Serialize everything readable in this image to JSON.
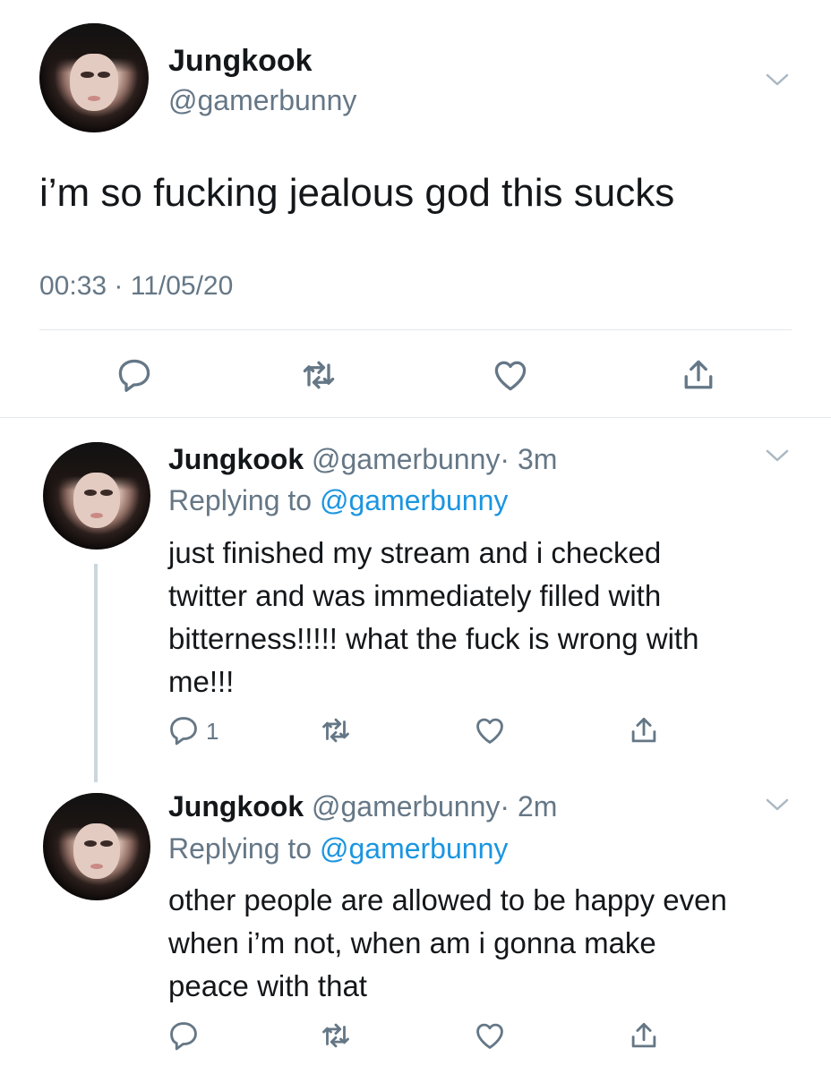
{
  "main_tweet": {
    "author_name": "Jungkook",
    "handle": "@gamerbunny",
    "text": "i’m so fucking jealous god this sucks",
    "timestamp": "00:33 · 11/05/20"
  },
  "replies": [
    {
      "author_name": "Jungkook",
      "handle": "@gamerbunny",
      "time": "· 3m",
      "replying_prefix": "Replying to",
      "replying_handle": "@gamerbunny",
      "lines": [
        "just finished my stream and i checked",
        "twitter and was immediately filled with",
        "bitterness!!!!! what the fuck is wrong with",
        "me!!!"
      ],
      "reply_count": "1"
    },
    {
      "author_name": "Jungkook",
      "handle": "@gamerbunny",
      "time": "· 2m",
      "replying_prefix": "Replying to",
      "replying_handle": "@gamerbunny",
      "lines": [
        "other people are allowed to be happy even",
        "when i’m not, when am i gonna make",
        "peace with that"
      ],
      "reply_count": ""
    }
  ],
  "icons": [
    "reply-icon",
    "retweet-icon",
    "like-icon",
    "share-icon",
    "chevron-down-icon"
  ],
  "colors": {
    "text": "#14171a",
    "secondary": "#657786",
    "link": "#1b95e0",
    "divider": "#e1e8ed"
  }
}
